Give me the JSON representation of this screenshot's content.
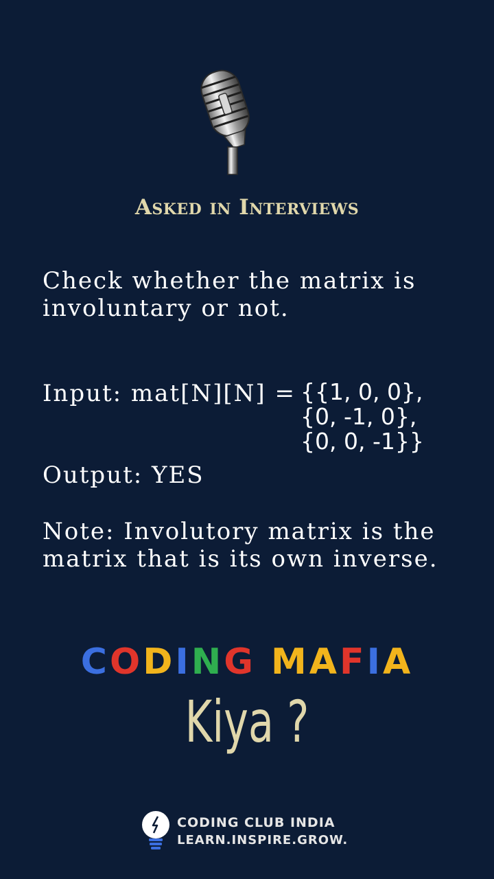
{
  "header": {
    "mic_icon": "microphone-icon",
    "title": "Asked in Interviews"
  },
  "question": {
    "text": "Check whether the matrix is involuntary or not."
  },
  "example": {
    "input_label": "Input: mat[N][N] =",
    "matrix_rows": [
      "{{1, 0, 0},",
      "{0, -1, 0},",
      "{0, 0, -1}}"
    ],
    "output": "Output: YES"
  },
  "note": {
    "text": "Note: Involutory matrix is the matrix that is its own inverse."
  },
  "brand": {
    "letters": [
      {
        "char": "C",
        "color": "#3b6fe0"
      },
      {
        "char": "O",
        "color": "#e0352b"
      },
      {
        "char": "D",
        "color": "#f2b41c"
      },
      {
        "char": "I",
        "color": "#3b6fe0"
      },
      {
        "char": "N",
        "color": "#2fae4f"
      },
      {
        "char": "G",
        "color": "#e0352b"
      },
      {
        "char": " ",
        "color": "#ffffff"
      },
      {
        "char": "M",
        "color": "#f2b41c"
      },
      {
        "char": "A",
        "color": "#f2b41c"
      },
      {
        "char": "F",
        "color": "#e0352b"
      },
      {
        "char": "I",
        "color": "#3b6fe0"
      },
      {
        "char": "A",
        "color": "#f2b41c"
      }
    ],
    "tagline": "Kiya ?"
  },
  "footer": {
    "logo_icon": "lightbulb-icon",
    "name": "CODING CLUB INDIA",
    "motto": "LEARN.INSPIRE.GROW."
  }
}
